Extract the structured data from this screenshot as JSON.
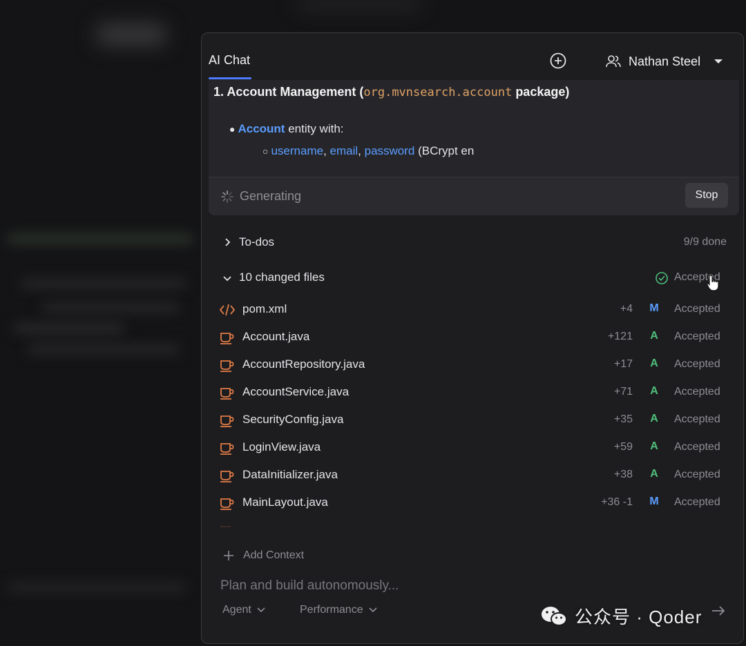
{
  "header": {
    "tab_label": "AI Chat",
    "user_name": "Nathan Steel"
  },
  "message": {
    "heading_prefix": "1. Account Management (",
    "heading_code": "org.mvnsearch.account",
    "heading_suffix": " package)",
    "bullet_entity": "Account",
    "bullet_entity_rest": " entity with:",
    "field_username": "username",
    "field_email": "email",
    "field_password": "password",
    "field_rest": " (BCrypt en",
    "sep": ", "
  },
  "generating": {
    "label": "Generating",
    "stop_label": "Stop"
  },
  "todos": {
    "label": "To-dos",
    "status": "9/9 done"
  },
  "changed": {
    "label": "10 changed files",
    "status": "Accepted"
  },
  "files": [
    {
      "name": "pom.xml",
      "diff": "+4",
      "status": "M",
      "state": "Accepted",
      "type": "xml"
    },
    {
      "name": "Account.java",
      "diff": "+121",
      "status": "A",
      "state": "Accepted",
      "type": "java"
    },
    {
      "name": "AccountRepository.java",
      "diff": "+17",
      "status": "A",
      "state": "Accepted",
      "type": "java"
    },
    {
      "name": "AccountService.java",
      "diff": "+71",
      "status": "A",
      "state": "Accepted",
      "type": "java"
    },
    {
      "name": "SecurityConfig.java",
      "diff": "+35",
      "status": "A",
      "state": "Accepted",
      "type": "java"
    },
    {
      "name": "LoginView.java",
      "diff": "+59",
      "status": "A",
      "state": "Accepted",
      "type": "java"
    },
    {
      "name": "DataInitializer.java",
      "diff": "+38",
      "status": "A",
      "state": "Accepted",
      "type": "java"
    },
    {
      "name": "MainLayout.java",
      "diff": "+36 -1",
      "status": "M",
      "state": "Accepted",
      "type": "java"
    }
  ],
  "composer": {
    "add_context": "Add Context",
    "placeholder": "Plan and build autonomously...",
    "mode_agent": "Agent",
    "mode_performance": "Performance"
  },
  "watermark": {
    "text": "公众号 · Qoder"
  },
  "colors": {
    "accent": "#4f7cff",
    "link": "#5b9dff",
    "added": "#4fbf7a",
    "modified": "#5b9dff",
    "code": "#e0a266",
    "java_icon": "#e07b45"
  }
}
